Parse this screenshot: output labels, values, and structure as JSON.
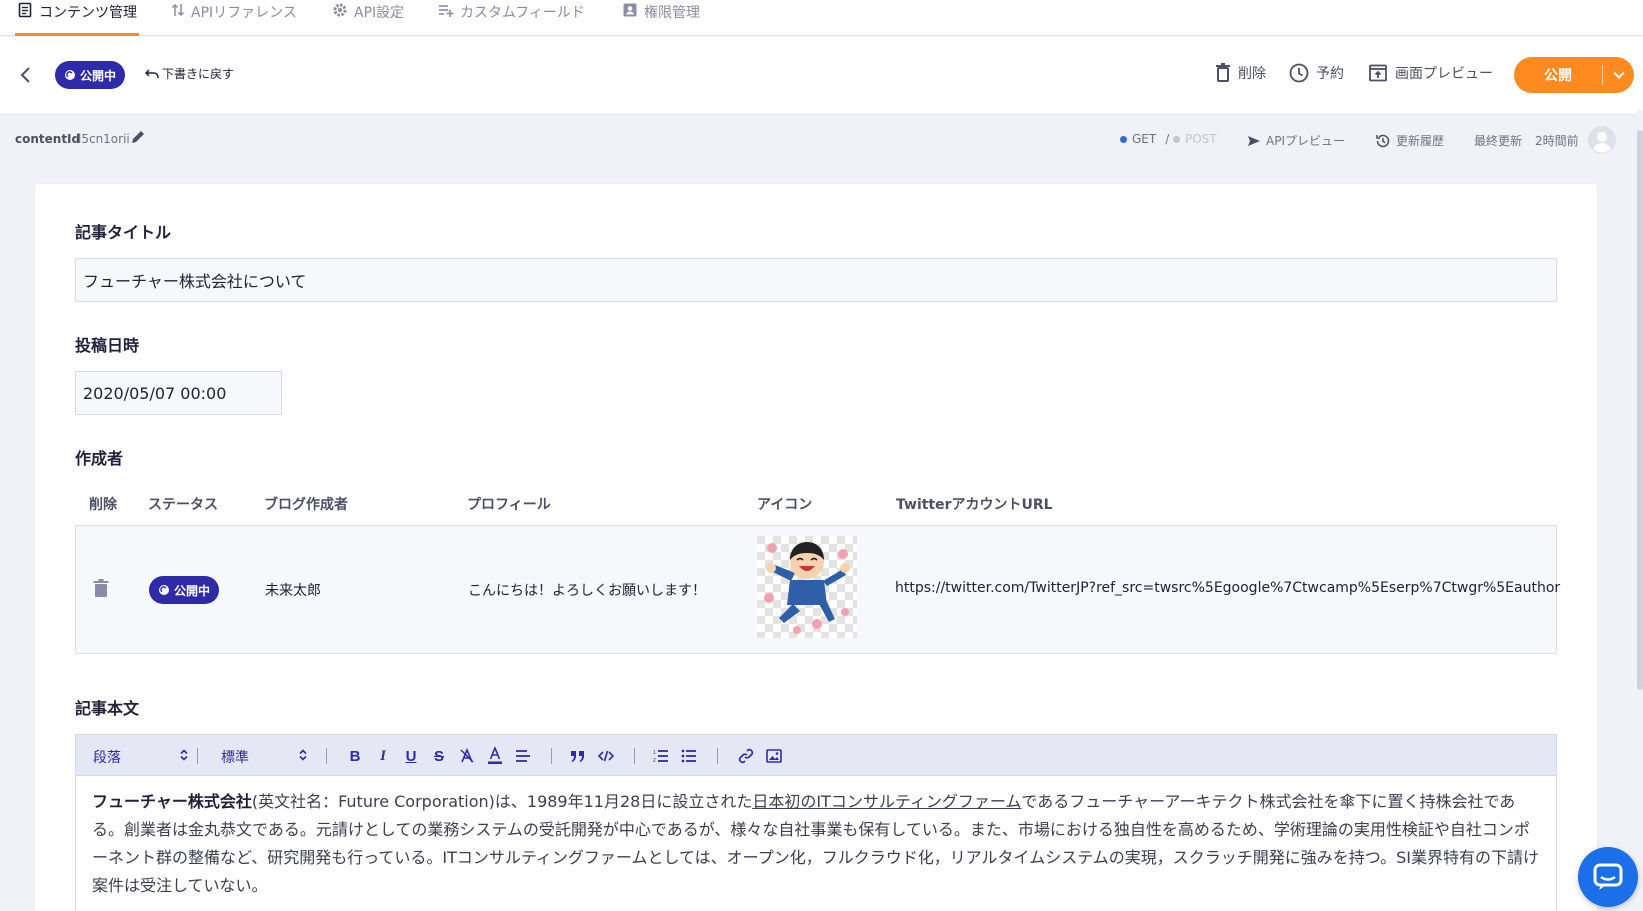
{
  "nav": {
    "tabs": [
      {
        "label": "コンテンツ管理",
        "icon": "document-icon",
        "active": true
      },
      {
        "label": "APIリファレンス",
        "icon": "sort-arrows-icon",
        "active": false
      },
      {
        "label": "API設定",
        "icon": "gear-icon",
        "active": false
      },
      {
        "label": "カスタムフィールド",
        "icon": "list-add-icon",
        "active": false
      },
      {
        "label": "権限管理",
        "icon": "user-badge-icon",
        "active": false
      }
    ]
  },
  "header": {
    "status": "公開中",
    "revert_label": "下書きに戻す",
    "delete_label": "削除",
    "schedule_label": "予約",
    "preview_label": "画面プレビュー",
    "publish_label": "公開"
  },
  "meta": {
    "content_id_label": "contentId",
    "content_id": "l5cn1orii",
    "get_label": "GET",
    "slash": "/",
    "post_label": "POST",
    "api_preview_label": "APIプレビュー",
    "history_label": "更新履歴",
    "last_updated_label": "最終更新",
    "last_updated_value": "2時間前"
  },
  "form": {
    "title_label": "記事タイトル",
    "title_value": "フューチャー株式会社について",
    "date_label": "投稿日時",
    "date_value": "2020/05/07 00:00",
    "author_label": "作成者",
    "body_label": "記事本文"
  },
  "author_table": {
    "headers": [
      "削除",
      "ステータス",
      "ブログ作成者",
      "プロフィール",
      "アイコン",
      "TwitterアカウントURL"
    ],
    "row": {
      "status": "公開中",
      "name": "未来太郎",
      "profile": "こんにちは！よろしくお願いします！",
      "url": "https://twitter.com/TwitterJP?ref_src=twsrc%5Egoogle%7Ctwcamp%5Eserp%7Ctwgr%5Eauthor"
    }
  },
  "editor": {
    "paragraph_select": "段落",
    "size_select": "標準",
    "body": {
      "bold_company": "フューチャー株式会社",
      "text1": "(英文社名：Future Corporation)は、1989年11月28日に設立された",
      "link_text": "日本初のITコンサルティングファーム",
      "text2": "であるフューチャーアーキテクト株式会社を傘下に置く持株会社である。創業者は金丸恭文である。元請けとしての業務システムの受託開発が中心であるが、様々な自社事業も保有している。また、市場における独自性を高めるため、学術理論の実用性検証や自社コンポーネント群の整備など、研究開発も行っている。ITコンサルティングファームとしては、オープン化，フルクラウド化，リアルタイムシステムの実現，スクラッチ開発に強みを持つ。SI業界特有の下請け案件は受注していない。"
    }
  },
  "colors": {
    "accent": "#ff8a1f",
    "brand": "#2f2aa8",
    "chat": "#1b6fe8"
  }
}
